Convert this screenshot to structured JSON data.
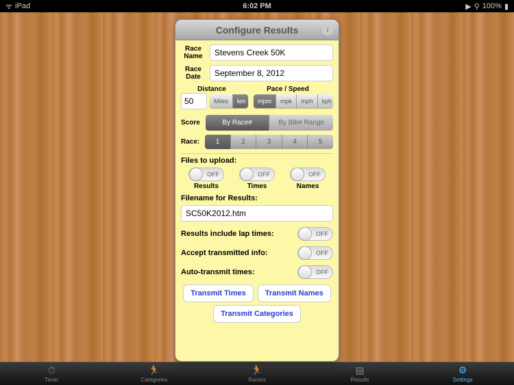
{
  "status": {
    "device": "iPad",
    "time": "6:02 PM",
    "battery": "100%"
  },
  "header": {
    "title": "Configure Results"
  },
  "race": {
    "name_label": "Race\nName",
    "name_value": "Stevens Creek 50K",
    "date_label": "Race\nDate",
    "date_value": "September 8, 2012"
  },
  "distance": {
    "header": "Distance",
    "value": "50",
    "units": [
      "Miles",
      "km"
    ],
    "selected": "km"
  },
  "pace": {
    "header": "Pace / Speed",
    "units": [
      "mpm",
      "mpk",
      "mph",
      "kph"
    ],
    "selected": "mpm"
  },
  "score": {
    "label": "Score",
    "options": [
      "By Race#",
      "By Bib# Range"
    ],
    "selected": "By Race#"
  },
  "race_sel": {
    "label": "Race:",
    "options": [
      "1",
      "2",
      "3",
      "4",
      "5"
    ],
    "selected": "1"
  },
  "upload": {
    "header": "Files to upload:",
    "items": [
      {
        "label": "Results",
        "state": "OFF"
      },
      {
        "label": "Times",
        "state": "OFF"
      },
      {
        "label": "Names",
        "state": "OFF"
      }
    ]
  },
  "filename": {
    "label": "Filename for Results:",
    "value": "SC50K2012.htm"
  },
  "opts": {
    "lap": {
      "label": "Results include lap times:",
      "state": "OFF"
    },
    "accept": {
      "label": "Accept transmitted info:",
      "state": "OFF"
    },
    "auto": {
      "label": "Auto-transmit times:",
      "state": "OFF"
    }
  },
  "buttons": {
    "times": "Transmit Times",
    "names": "Transmit Names",
    "categories": "Transmit Categories"
  },
  "tabs": [
    {
      "icon": "⏱",
      "label": "Timer"
    },
    {
      "icon": "🏃",
      "label": "Categories"
    },
    {
      "icon": "🏃",
      "label": "Racers"
    },
    {
      "icon": "▤",
      "label": "Results"
    },
    {
      "icon": "⚙",
      "label": "Settings"
    }
  ],
  "active_tab": "Settings"
}
